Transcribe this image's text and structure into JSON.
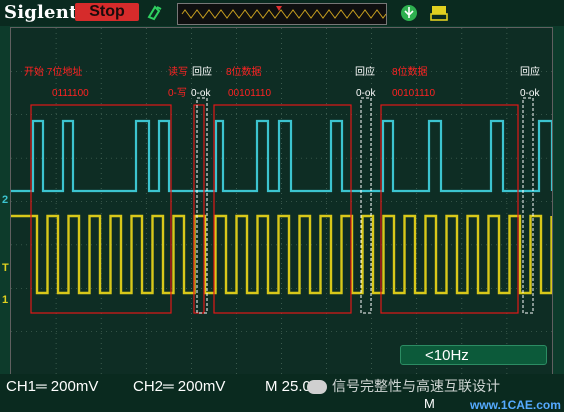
{
  "brand": "Siglent",
  "run_state": "Stop",
  "icons": [
    "trigger-hand-icon",
    "usb-icon",
    "printer-icon"
  ],
  "annotations": {
    "start_addr": "开始 7位地址",
    "addr_bits": "0111100",
    "rw": "读写",
    "rw_value": "0-写",
    "ack1": "回应",
    "ack1_value": "0-ok",
    "data1": "8位数据",
    "data1_bits": "00101110",
    "ack2": "回应",
    "ack2_value": "0-ok",
    "data2": "8位数据",
    "data2_bits": "00101110",
    "ack3": "回应",
    "ack3_value": "0-ok"
  },
  "markers": {
    "ch2": "2",
    "trigger": "T",
    "ch1": "1"
  },
  "status": {
    "ch1": "CH1═ 200mV",
    "ch2": "CH2═ 200mV",
    "timebase": "M 25.0us",
    "timebase2": "M"
  },
  "frequency": "<10Hz",
  "watermark": "信号完整性与高速互联设计",
  "site": "www.1CAE.com",
  "colors": {
    "ch1": "#d8c81a",
    "ch2": "#3cc4cf",
    "annotation_box": "#e01818",
    "grid": "#5a7a6a"
  }
}
